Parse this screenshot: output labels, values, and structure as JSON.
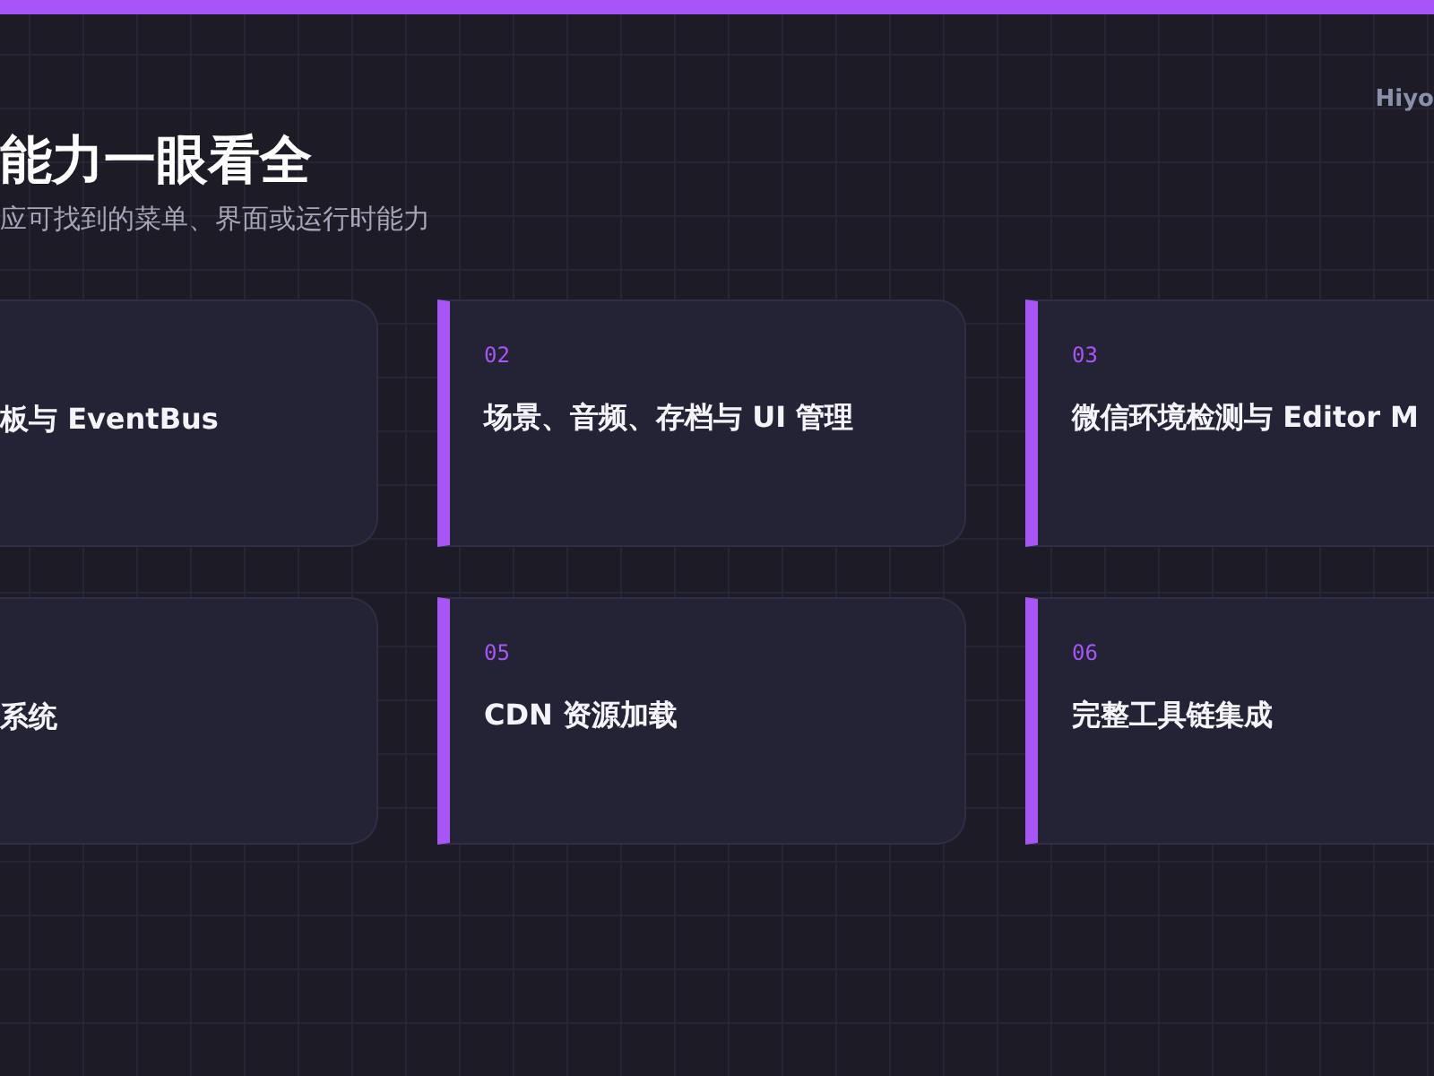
{
  "header": {
    "title": "能力一眼看全",
    "subtitle": "应可找到的菜单、界面或运行时能力",
    "brand": "Hiyo"
  },
  "cards": [
    {
      "kind": "partial",
      "title": "板与 EventBus"
    },
    {
      "kind": "full",
      "number": "02",
      "title": "场景、音频、存档与 UI 管理"
    },
    {
      "kind": "full",
      "number": "03",
      "title": "微信环境检测与 Editor M"
    },
    {
      "kind": "partial",
      "title": "系统"
    },
    {
      "kind": "full",
      "number": "05",
      "title": "CDN 资源加载"
    },
    {
      "kind": "full",
      "number": "06",
      "title": "完整工具链集成"
    }
  ]
}
